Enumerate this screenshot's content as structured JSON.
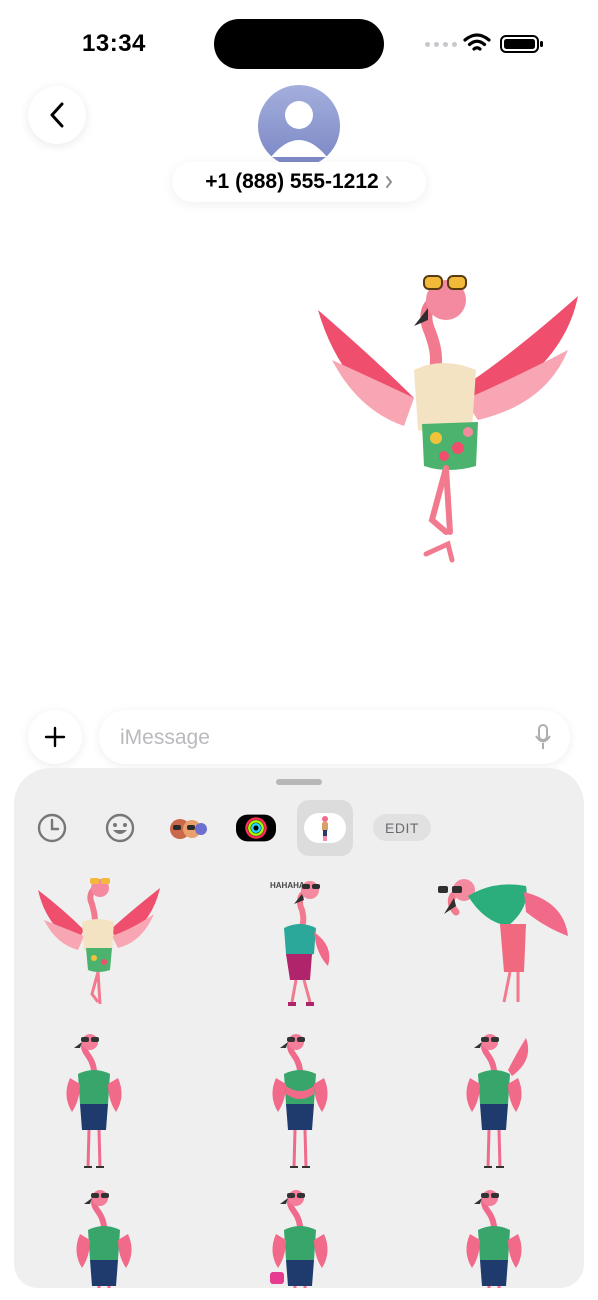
{
  "status_bar": {
    "time": "13:34"
  },
  "header": {
    "contact_name": "+1 (888) 555-1212"
  },
  "composer": {
    "placeholder": "iMessage"
  },
  "sticker_drawer": {
    "edit_label": "EDIT",
    "tabs": [
      "recents-icon",
      "emoji-icon",
      "memoji-icon",
      "activity-rings-icon",
      "flamingo-sticker-pack-icon"
    ],
    "sticker_speech_text": "HAHAHA",
    "stickers": [
      "flamingo-wings-spread-sticker",
      "flamingo-laughing-sticker",
      "flamingo-bowing-sticker",
      "flamingo-hands-on-hips-sticker",
      "flamingo-arms-crossed-sticker",
      "flamingo-waving-sticker",
      "flamingo-standing-sticker",
      "flamingo-handbag-sticker",
      "flamingo-posing-sticker"
    ]
  },
  "colors": {
    "accent_pink": "#f0577a",
    "drawer_bg": "#efefef",
    "avatar": "#8a95cf"
  }
}
